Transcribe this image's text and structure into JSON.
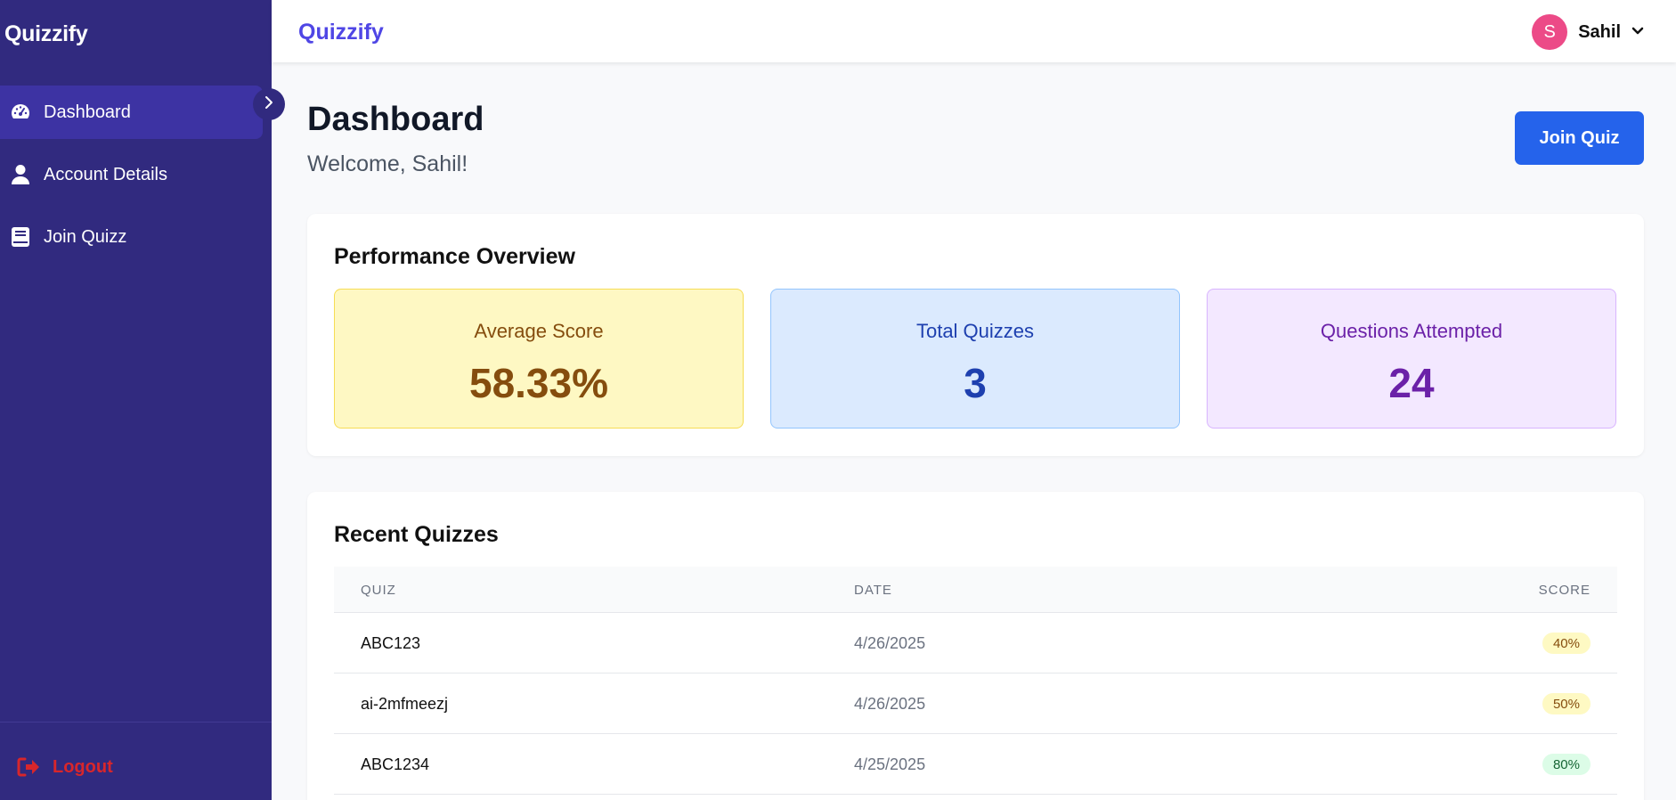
{
  "sidebar": {
    "brand": "Quizzify",
    "items": [
      {
        "label": "Dashboard",
        "icon": "speedometer-icon",
        "active": true
      },
      {
        "label": "Account Details",
        "icon": "user-icon",
        "active": false
      },
      {
        "label": "Join Quizz",
        "icon": "book-icon",
        "active": false
      }
    ],
    "toggle_icon": "chevron-right-icon",
    "logout_label": "Logout",
    "logout_icon": "sign-out-icon"
  },
  "topbar": {
    "brand": "Quizzify",
    "user": {
      "initial": "S",
      "name": "Sahil",
      "menu_icon": "chevron-down-icon"
    }
  },
  "main": {
    "title": "Dashboard",
    "welcome": "Welcome, Sahil!",
    "join_button": "Join Quiz"
  },
  "performance": {
    "title": "Performance Overview",
    "stats": [
      {
        "label": "Average Score",
        "value": "58.33%",
        "color": "#854d0e"
      },
      {
        "label": "Total Quizzes",
        "value": "3",
        "color": "#1e40af"
      },
      {
        "label": "Questions Attempted",
        "value": "24",
        "color": "#6b21a8"
      }
    ]
  },
  "recent": {
    "title": "Recent Quizzes",
    "columns": [
      "QUIZ",
      "DATE",
      "SCORE"
    ],
    "rows": [
      {
        "quiz": "ABC123",
        "date": "4/26/2025",
        "score": "40%"
      },
      {
        "quiz": "ai-2mfmeezj",
        "date": "4/26/2025",
        "score": "50%"
      },
      {
        "quiz": "ABC1234",
        "date": "4/25/2025",
        "score": "80%"
      }
    ]
  },
  "colors": {
    "sidebar": "#312a7f",
    "sidebar_active": "#3d33a3",
    "accent": "#4f46e5",
    "primary_button": "#2563eb",
    "logout": "#d8262b",
    "avatar": "#ec4a87"
  }
}
